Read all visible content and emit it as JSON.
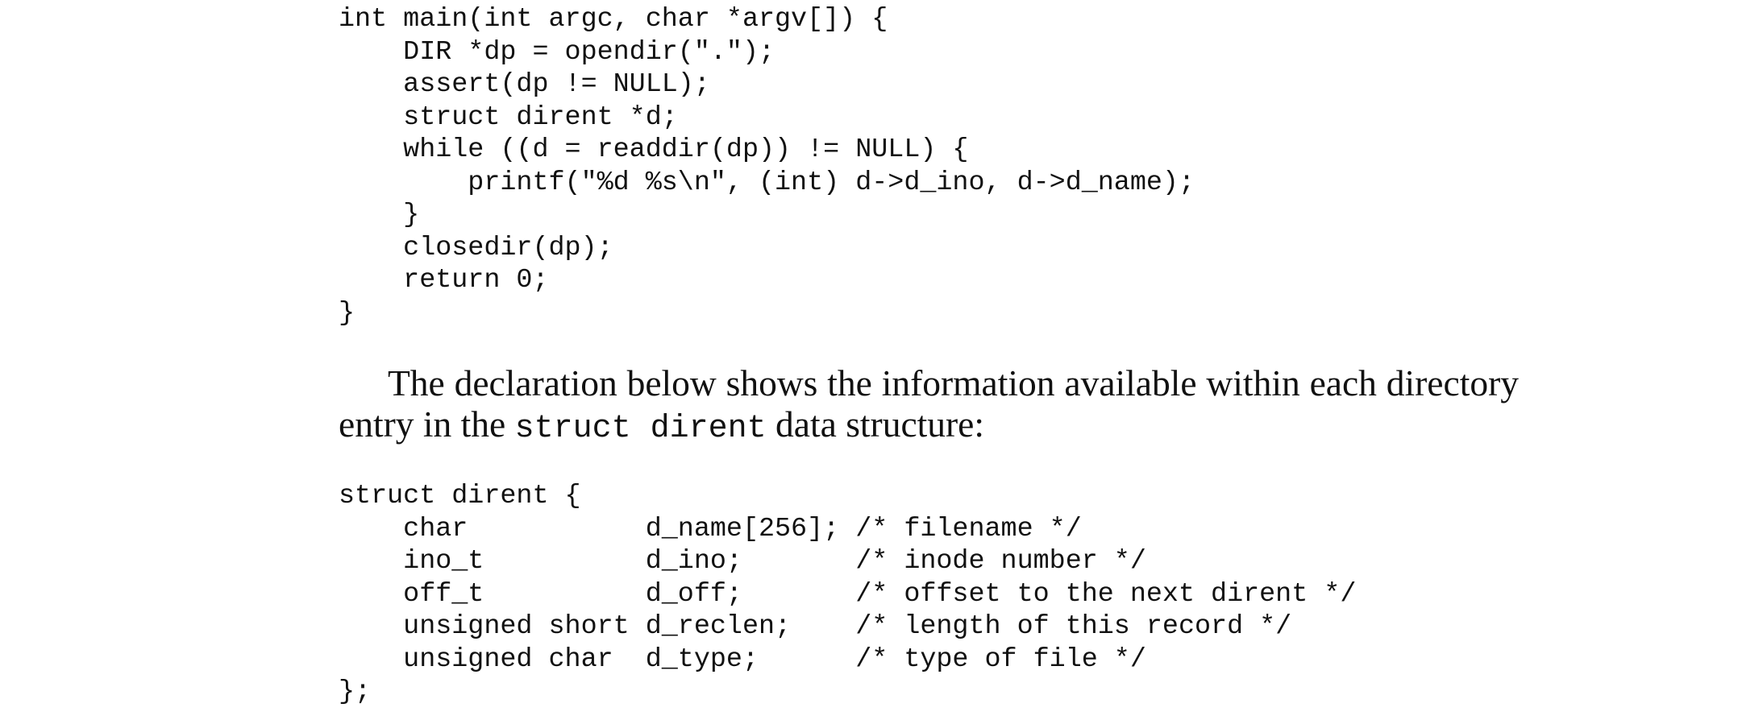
{
  "code_listing_1": {
    "lines": [
      "int main(int argc, char *argv[]) {",
      "    DIR *dp = opendir(\".\");",
      "    assert(dp != NULL);",
      "    struct dirent *d;",
      "    while ((d = readdir(dp)) != NULL) {",
      "        printf(\"%d %s\\n\", (int) d->d_ino, d->d_name);",
      "    }",
      "    closedir(dp);",
      "    return 0;",
      "}"
    ]
  },
  "paragraph": {
    "text_before": "The declaration below shows the information available within each directory entry in the ",
    "inline_code": "struct dirent",
    "text_after": " data structure:"
  },
  "code_listing_2": {
    "lines": [
      "struct dirent {",
      "    char           d_name[256]; /* filename */",
      "    ino_t          d_ino;       /* inode number */",
      "    off_t          d_off;       /* offset to the next dirent */",
      "    unsigned short d_reclen;    /* length of this record */",
      "    unsigned char  d_type;      /* type of file */",
      "};"
    ]
  }
}
